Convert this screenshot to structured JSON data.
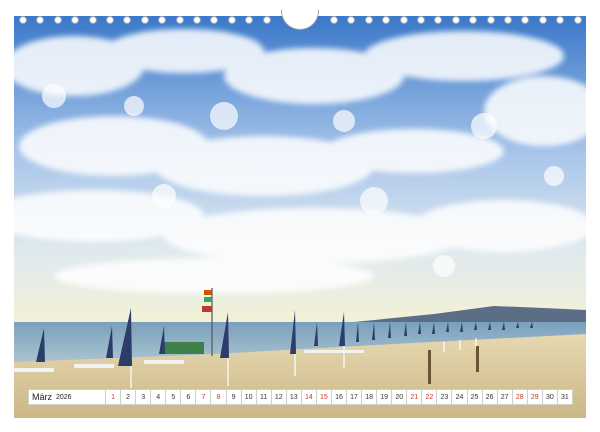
{
  "calendar": {
    "month": "März",
    "year": "2026",
    "days": [
      {
        "n": "1",
        "weekend": true
      },
      {
        "n": "2",
        "weekend": false
      },
      {
        "n": "3",
        "weekend": false
      },
      {
        "n": "4",
        "weekend": false
      },
      {
        "n": "5",
        "weekend": false
      },
      {
        "n": "6",
        "weekend": false
      },
      {
        "n": "7",
        "weekend": true
      },
      {
        "n": "8",
        "weekend": true
      },
      {
        "n": "9",
        "weekend": false
      },
      {
        "n": "10",
        "weekend": false
      },
      {
        "n": "11",
        "weekend": false
      },
      {
        "n": "12",
        "weekend": false
      },
      {
        "n": "13",
        "weekend": false
      },
      {
        "n": "14",
        "weekend": true
      },
      {
        "n": "15",
        "weekend": true
      },
      {
        "n": "16",
        "weekend": false
      },
      {
        "n": "17",
        "weekend": false
      },
      {
        "n": "18",
        "weekend": false
      },
      {
        "n": "19",
        "weekend": false
      },
      {
        "n": "20",
        "weekend": false
      },
      {
        "n": "21",
        "weekend": true
      },
      {
        "n": "22",
        "weekend": true
      },
      {
        "n": "23",
        "weekend": false
      },
      {
        "n": "24",
        "weekend": false
      },
      {
        "n": "25",
        "weekend": false
      },
      {
        "n": "26",
        "weekend": false
      },
      {
        "n": "27",
        "weekend": false
      },
      {
        "n": "28",
        "weekend": true
      },
      {
        "n": "29",
        "weekend": true
      },
      {
        "n": "30",
        "weekend": false
      },
      {
        "n": "31",
        "weekend": false
      }
    ]
  },
  "colors": {
    "sky_top": "#2f6fc4",
    "sky_mid": "#8fb6e6",
    "horizon": "#f3f0d2",
    "sea": "#6f95b3",
    "sand": "#d8c79c",
    "umbrella": "#2c3d6b",
    "weekend_text": "#c0392b"
  }
}
